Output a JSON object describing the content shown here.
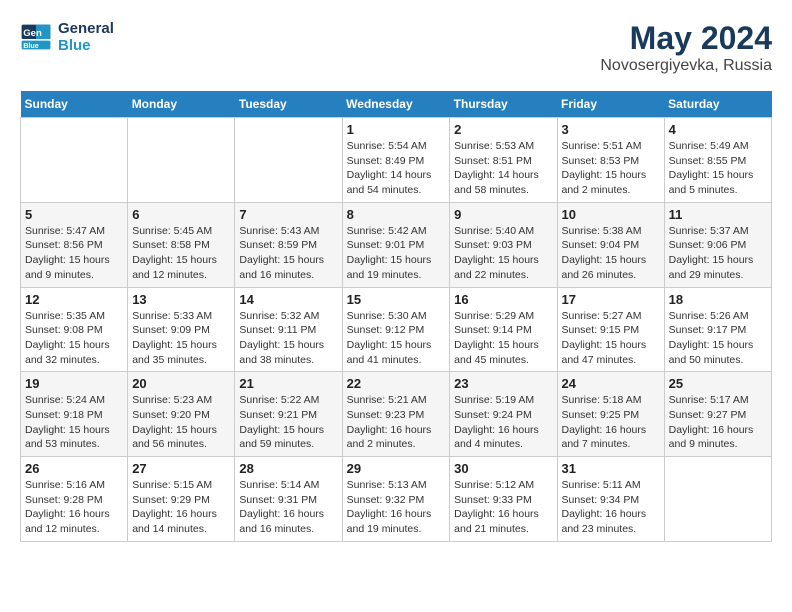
{
  "logo": {
    "line1": "General",
    "line2": "Blue"
  },
  "title": "May 2024",
  "location": "Novosergiyevka, Russia",
  "weekdays": [
    "Sunday",
    "Monday",
    "Tuesday",
    "Wednesday",
    "Thursday",
    "Friday",
    "Saturday"
  ],
  "weeks": [
    [
      {
        "day": "",
        "info": ""
      },
      {
        "day": "",
        "info": ""
      },
      {
        "day": "",
        "info": ""
      },
      {
        "day": "1",
        "info": "Sunrise: 5:54 AM\nSunset: 8:49 PM\nDaylight: 14 hours\nand 54 minutes."
      },
      {
        "day": "2",
        "info": "Sunrise: 5:53 AM\nSunset: 8:51 PM\nDaylight: 14 hours\nand 58 minutes."
      },
      {
        "day": "3",
        "info": "Sunrise: 5:51 AM\nSunset: 8:53 PM\nDaylight: 15 hours\nand 2 minutes."
      },
      {
        "day": "4",
        "info": "Sunrise: 5:49 AM\nSunset: 8:55 PM\nDaylight: 15 hours\nand 5 minutes."
      }
    ],
    [
      {
        "day": "5",
        "info": "Sunrise: 5:47 AM\nSunset: 8:56 PM\nDaylight: 15 hours\nand 9 minutes."
      },
      {
        "day": "6",
        "info": "Sunrise: 5:45 AM\nSunset: 8:58 PM\nDaylight: 15 hours\nand 12 minutes."
      },
      {
        "day": "7",
        "info": "Sunrise: 5:43 AM\nSunset: 8:59 PM\nDaylight: 15 hours\nand 16 minutes."
      },
      {
        "day": "8",
        "info": "Sunrise: 5:42 AM\nSunset: 9:01 PM\nDaylight: 15 hours\nand 19 minutes."
      },
      {
        "day": "9",
        "info": "Sunrise: 5:40 AM\nSunset: 9:03 PM\nDaylight: 15 hours\nand 22 minutes."
      },
      {
        "day": "10",
        "info": "Sunrise: 5:38 AM\nSunset: 9:04 PM\nDaylight: 15 hours\nand 26 minutes."
      },
      {
        "day": "11",
        "info": "Sunrise: 5:37 AM\nSunset: 9:06 PM\nDaylight: 15 hours\nand 29 minutes."
      }
    ],
    [
      {
        "day": "12",
        "info": "Sunrise: 5:35 AM\nSunset: 9:08 PM\nDaylight: 15 hours\nand 32 minutes."
      },
      {
        "day": "13",
        "info": "Sunrise: 5:33 AM\nSunset: 9:09 PM\nDaylight: 15 hours\nand 35 minutes."
      },
      {
        "day": "14",
        "info": "Sunrise: 5:32 AM\nSunset: 9:11 PM\nDaylight: 15 hours\nand 38 minutes."
      },
      {
        "day": "15",
        "info": "Sunrise: 5:30 AM\nSunset: 9:12 PM\nDaylight: 15 hours\nand 41 minutes."
      },
      {
        "day": "16",
        "info": "Sunrise: 5:29 AM\nSunset: 9:14 PM\nDaylight: 15 hours\nand 45 minutes."
      },
      {
        "day": "17",
        "info": "Sunrise: 5:27 AM\nSunset: 9:15 PM\nDaylight: 15 hours\nand 47 minutes."
      },
      {
        "day": "18",
        "info": "Sunrise: 5:26 AM\nSunset: 9:17 PM\nDaylight: 15 hours\nand 50 minutes."
      }
    ],
    [
      {
        "day": "19",
        "info": "Sunrise: 5:24 AM\nSunset: 9:18 PM\nDaylight: 15 hours\nand 53 minutes."
      },
      {
        "day": "20",
        "info": "Sunrise: 5:23 AM\nSunset: 9:20 PM\nDaylight: 15 hours\nand 56 minutes."
      },
      {
        "day": "21",
        "info": "Sunrise: 5:22 AM\nSunset: 9:21 PM\nDaylight: 15 hours\nand 59 minutes."
      },
      {
        "day": "22",
        "info": "Sunrise: 5:21 AM\nSunset: 9:23 PM\nDaylight: 16 hours\nand 2 minutes."
      },
      {
        "day": "23",
        "info": "Sunrise: 5:19 AM\nSunset: 9:24 PM\nDaylight: 16 hours\nand 4 minutes."
      },
      {
        "day": "24",
        "info": "Sunrise: 5:18 AM\nSunset: 9:25 PM\nDaylight: 16 hours\nand 7 minutes."
      },
      {
        "day": "25",
        "info": "Sunrise: 5:17 AM\nSunset: 9:27 PM\nDaylight: 16 hours\nand 9 minutes."
      }
    ],
    [
      {
        "day": "26",
        "info": "Sunrise: 5:16 AM\nSunset: 9:28 PM\nDaylight: 16 hours\nand 12 minutes."
      },
      {
        "day": "27",
        "info": "Sunrise: 5:15 AM\nSunset: 9:29 PM\nDaylight: 16 hours\nand 14 minutes."
      },
      {
        "day": "28",
        "info": "Sunrise: 5:14 AM\nSunset: 9:31 PM\nDaylight: 16 hours\nand 16 minutes."
      },
      {
        "day": "29",
        "info": "Sunrise: 5:13 AM\nSunset: 9:32 PM\nDaylight: 16 hours\nand 19 minutes."
      },
      {
        "day": "30",
        "info": "Sunrise: 5:12 AM\nSunset: 9:33 PM\nDaylight: 16 hours\nand 21 minutes."
      },
      {
        "day": "31",
        "info": "Sunrise: 5:11 AM\nSunset: 9:34 PM\nDaylight: 16 hours\nand 23 minutes."
      },
      {
        "day": "",
        "info": ""
      }
    ]
  ]
}
